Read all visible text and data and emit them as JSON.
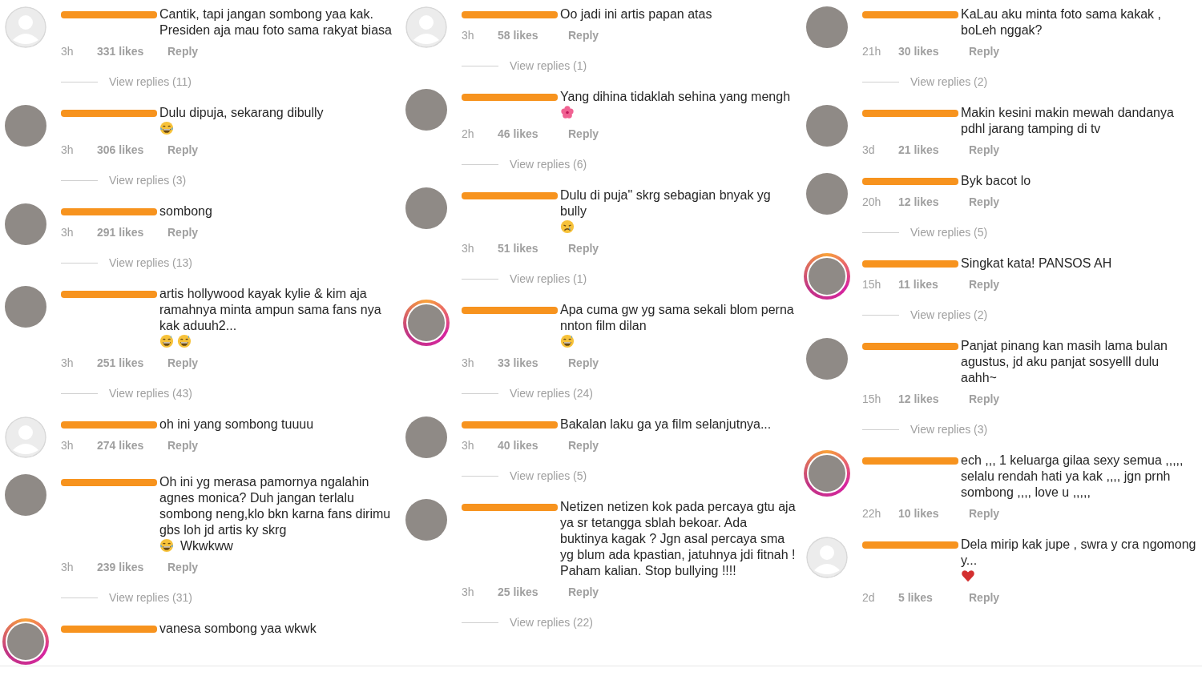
{
  "columns": [
    {
      "comments": [
        {
          "avatar": {
            "kind": "default",
            "story_ring": false
          },
          "text": "Cantik, tapi jangan sombong yaa kak. Presiden aja mau foto sama rakyat biasa",
          "time": "3h",
          "likes": "331 likes",
          "reply": "Reply",
          "view_replies": "View replies (11)"
        },
        {
          "avatar": {
            "kind": "photo",
            "story_ring": false
          },
          "text": "Dulu dipuja, sekarang dibully",
          "emojis": [
            {
              "kind": "tears_of_joy"
            }
          ],
          "time": "3h",
          "likes": "306 likes",
          "reply": "Reply",
          "view_replies": "View replies (3)"
        },
        {
          "avatar": {
            "kind": "photo",
            "story_ring": false
          },
          "text": "sombong",
          "time": "3h",
          "likes": "291 likes",
          "reply": "Reply",
          "view_replies": "View replies (13)"
        },
        {
          "avatar": {
            "kind": "photo",
            "story_ring": false
          },
          "text": "artis hollywood kayak kylie & kim aja ramahnya minta ampun sama fans nya kak aduuh2...",
          "emojis": [
            {
              "kind": "grin_sweat"
            },
            {
              "kind": "grin_sweat"
            }
          ],
          "time": "3h",
          "likes": "251 likes",
          "reply": "Reply",
          "view_replies": "View replies (43)"
        },
        {
          "avatar": {
            "kind": "default",
            "story_ring": false
          },
          "text": "oh ini yang sombong tuuuu",
          "time": "3h",
          "likes": "274 likes",
          "reply": "Reply"
        },
        {
          "avatar": {
            "kind": "photo",
            "story_ring": false
          },
          "text": "Oh ini yg merasa pamornya ngalahin agnes monica? Duh jangan terlalu sombong neng,klo bkn karna fans dirimu gbs loh jd artis ky skrg",
          "emojis": [
            {
              "kind": "tears_of_joy"
            }
          ],
          "text_after": "Wkwkww",
          "time": "3h",
          "likes": "239 likes",
          "reply": "Reply",
          "view_replies": "View replies (31)"
        },
        {
          "avatar": {
            "kind": "photo",
            "story_ring": true
          },
          "text": "vanesa sombong yaa wkwk"
        }
      ]
    },
    {
      "comments": [
        {
          "avatar": {
            "kind": "default",
            "story_ring": false
          },
          "text": "Oo jadi ini artis papan atas",
          "time": "3h",
          "likes": "58 likes",
          "reply": "Reply",
          "view_replies": "View replies (1)"
        },
        {
          "avatar": {
            "kind": "photo",
            "story_ring": false
          },
          "text": "Yang dihina tidaklah sehina yang mengh",
          "emojis": [
            {
              "kind": "flower"
            }
          ],
          "time": "2h",
          "likes": "46 likes",
          "reply": "Reply",
          "view_replies": "View replies (6)"
        },
        {
          "avatar": {
            "kind": "photo",
            "story_ring": false
          },
          "text": "Dulu di puja\" skrg sebagian bnyak yg bully",
          "emojis": [
            {
              "kind": "crying"
            }
          ],
          "time": "3h",
          "likes": "51 likes",
          "reply": "Reply",
          "view_replies": "View replies (1)"
        },
        {
          "avatar": {
            "kind": "photo",
            "story_ring": true
          },
          "text": "Apa cuma gw yg sama sekali blom perna nnton film dilan",
          "emojis": [
            {
              "kind": "grin_sweat"
            }
          ],
          "time": "3h",
          "likes": "33 likes",
          "reply": "Reply",
          "view_replies": "View replies (24)"
        },
        {
          "avatar": {
            "kind": "photo",
            "story_ring": false
          },
          "text": "Bakalan laku ga ya film selanjutnya...",
          "time": "3h",
          "likes": "40 likes",
          "reply": "Reply",
          "view_replies": "View replies (5)"
        },
        {
          "avatar": {
            "kind": "photo",
            "story_ring": false
          },
          "text": "Netizen netizen kok pada percaya gtu aja ya sr tetangga sblah bekoar. Ada buktinya kagak ? Jgn asal percaya sma yg blum ada kpastian, jatuhnya jdi fitnah ! Paham kalian. Stop bullying !!!!",
          "time": "3h",
          "likes": "25 likes",
          "reply": "Reply",
          "view_replies": "View replies (22)"
        }
      ]
    },
    {
      "comments": [
        {
          "avatar": {
            "kind": "photo",
            "story_ring": false
          },
          "text": "KaLau aku minta foto sama kakak , boLeh nggak?",
          "time": "21h",
          "likes": "30 likes",
          "reply": "Reply",
          "view_replies": "View replies (2)"
        },
        {
          "avatar": {
            "kind": "photo",
            "story_ring": false
          },
          "text": "Makin kesini makin mewah dandanya pdhl jarang tamping di tv",
          "time": "3d",
          "likes": "21 likes",
          "reply": "Reply"
        },
        {
          "avatar": {
            "kind": "photo",
            "story_ring": false
          },
          "text": "Byk bacot lo",
          "time": "20h",
          "likes": "12 likes",
          "reply": "Reply",
          "view_replies": "View replies (5)"
        },
        {
          "avatar": {
            "kind": "photo",
            "story_ring": true
          },
          "text": "Singkat kata! PANSOS AH",
          "time": "15h",
          "likes": "11 likes",
          "reply": "Reply",
          "view_replies": "View replies (2)"
        },
        {
          "avatar": {
            "kind": "photo",
            "story_ring": false
          },
          "text": "Panjat pinang kan masih lama bulan agustus, jd aku panjat sosyelll dulu aahh~",
          "time": "15h",
          "likes": "12 likes",
          "reply": "Reply",
          "view_replies": "View replies (3)"
        },
        {
          "avatar": {
            "kind": "photo",
            "story_ring": true
          },
          "text": "ech ,,, 1 keluarga gilaa sexy semua ,,,,, selalu rendah hati ya kak ,,,, jgn prnh sombong ,,,, love u ,,,,,",
          "time": "22h",
          "likes": "10 likes",
          "reply": "Reply"
        },
        {
          "avatar": {
            "kind": "default",
            "story_ring": false
          },
          "text": "Dela mirip kak jupe , swra y cra ngomong y...",
          "emojis": [
            {
              "kind": "heart"
            }
          ],
          "time": "2d",
          "likes": "5 likes",
          "reply": "Reply"
        }
      ]
    }
  ]
}
